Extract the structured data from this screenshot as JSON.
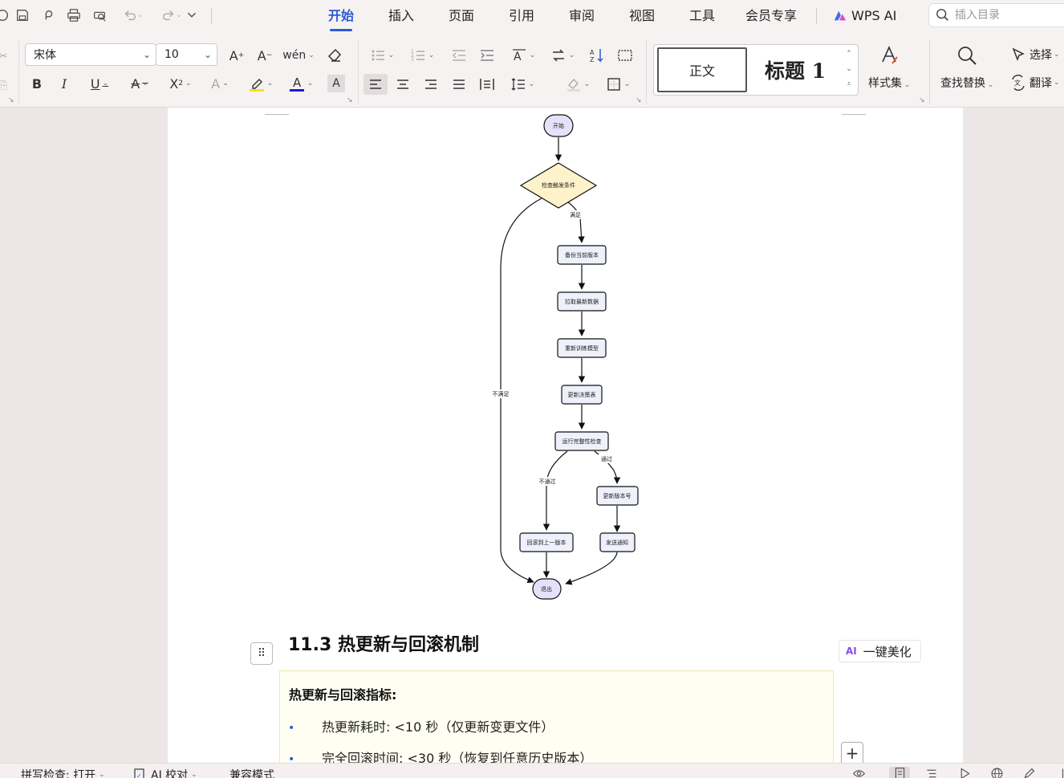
{
  "menu": {
    "tabs": [
      "开始",
      "插入",
      "页面",
      "引用",
      "审阅",
      "视图",
      "工具",
      "会员专享"
    ],
    "active_tab": "开始",
    "wps_ai": "WPS AI",
    "search_placeholder": "插入目录"
  },
  "ribbon": {
    "font_name": "宋体",
    "font_size": "10",
    "pinyin_label": "wén",
    "styles": {
      "normal": "正文",
      "heading1": "标题 1",
      "style_set": "样式集"
    },
    "find_replace": "查找替换",
    "select": "选择",
    "translate": "翻译",
    "colors": {
      "highlight": "#f5e400",
      "font_color": "#1a1adb",
      "accent": "#2a5bd7"
    }
  },
  "flowchart": {
    "nodes": {
      "start": "开始",
      "check": "检查触发条件",
      "backup": "备份当前版本",
      "pull": "拉取最新数据",
      "retrain": "重新训练模型",
      "update_table": "更新决策表",
      "integrity": "运行完整性检查",
      "update_version": "更新版本号",
      "rollback": "回滚到上一版本",
      "notify": "发送通知",
      "exit": "退出"
    },
    "edges": {
      "satisfied": "满足",
      "not_satisfied": "不满足",
      "pass": "通过",
      "fail": "不通过"
    }
  },
  "document": {
    "heading": "11.3 热更新与回滚机制",
    "ai_beautify": "一键美化",
    "ai_badge": "AI",
    "callout_title": "热更新与回滚指标:",
    "bullets": [
      "热更新耗时: <10 秒（仅更新变更文件）",
      "完全回滚时间: <30 秒（恢复到任意历史版本）"
    ]
  },
  "statusbar": {
    "spellcheck": "拼写检查: 打开",
    "ai_proof": "AI 校对",
    "compat": "兼容模式"
  }
}
